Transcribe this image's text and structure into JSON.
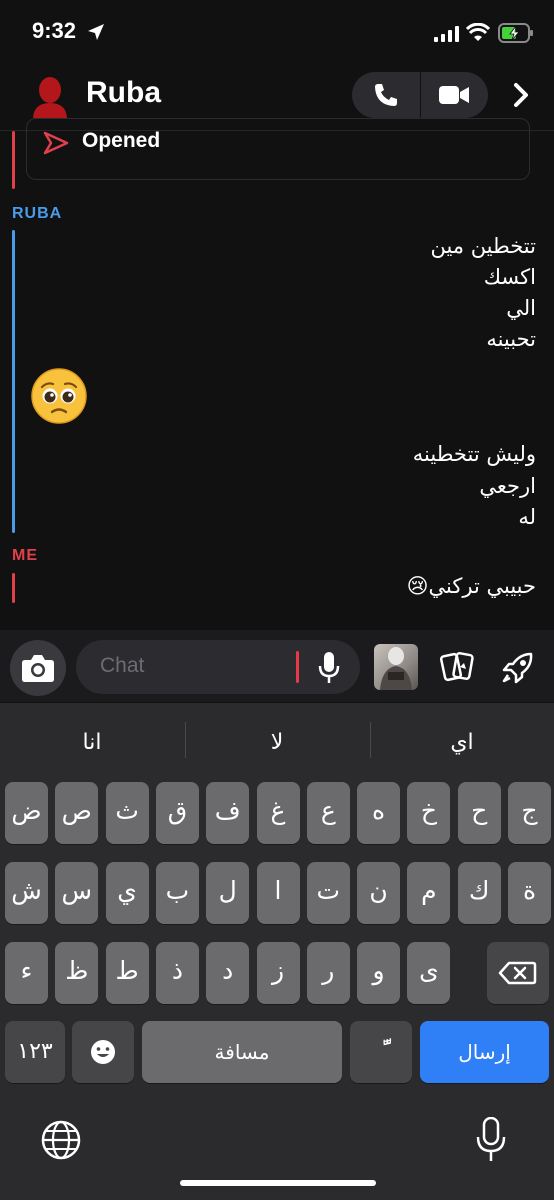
{
  "status_bar": {
    "time": "9:32"
  },
  "header": {
    "contact_name": "Ruba"
  },
  "chat": {
    "opened_label": "Opened",
    "messages": [
      {
        "sender": "RUBA",
        "sender_color": "#4a9be8",
        "lines": [
          "تتخطين مين",
          "اكسك",
          "الي",
          "تحبينه",
          "🥺",
          "وليش تتخطينه",
          "ارجعي",
          "له"
        ]
      },
      {
        "sender": "ME",
        "sender_color": "#e0404a",
        "lines": [
          "حبيبي تركني😢"
        ]
      }
    ]
  },
  "input": {
    "placeholder": "Chat"
  },
  "keyboard": {
    "suggestions": [
      "انا",
      "لا",
      "اي"
    ],
    "row1": [
      "ض",
      "ص",
      "ث",
      "ق",
      "ف",
      "غ",
      "ع",
      "ه",
      "خ",
      "ح",
      "ج"
    ],
    "row2": [
      "ش",
      "س",
      "ي",
      "ب",
      "ل",
      "ا",
      "ت",
      "ن",
      "م",
      "ك",
      "ة"
    ],
    "row3": [
      "ء",
      "ظ",
      "ط",
      "ذ",
      "د",
      "ز",
      "ر",
      "و",
      "ى"
    ],
    "numbers_label": "١٢٣",
    "space_label": "مسافة",
    "diacritic_label": "ًّ",
    "send_label": "إرسال"
  },
  "colors": {
    "accent_blue": "#2f7ff7",
    "ruba_blue": "#4a9be8",
    "me_red": "#e0404a"
  }
}
